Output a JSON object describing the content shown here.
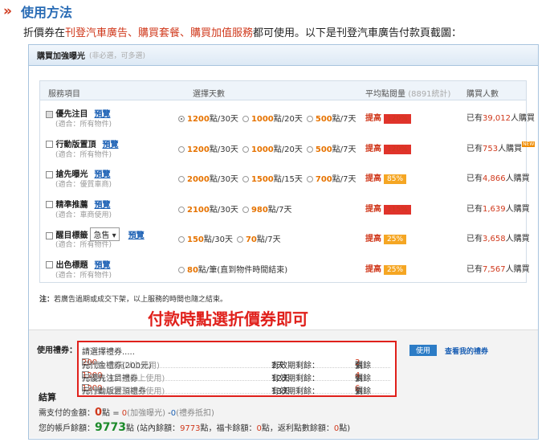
{
  "header": {
    "icon": "»",
    "title": "使用方法"
  },
  "intro": {
    "prefix": "折價券在",
    "highlight": "刊登汽車廣告、購買套餐、購買加值服務",
    "suffix": "都可使用。以下是刊登汽車廣告付款頁截圖："
  },
  "section": {
    "title": "購買加強曝光",
    "subtitle": "(非必選，可多選)"
  },
  "table": {
    "headers": {
      "item": "服務項目",
      "days": "選擇天數",
      "views": "平均點閱量",
      "views_note": "(8891統計)",
      "buyers": "購買人數"
    },
    "preview": "預覽",
    "rows": [
      {
        "name": "優先注目",
        "sub": "(適合：所有物件)",
        "checked": true,
        "preview": true,
        "options": [
          {
            "pts": "1200",
            "unit": "點/30天",
            "on": true
          },
          {
            "pts": "1000",
            "unit": "點/20天"
          },
          {
            "pts": "500",
            "unit": "點/7天"
          }
        ],
        "rank_label": "提高",
        "rank": "120%",
        "badge": "red",
        "buyers_pre": "已有",
        "buyers": "39,012",
        "buyers_post": "人購買"
      },
      {
        "name": "行動版置頂",
        "sub": "(適合：所有物件)",
        "preview": true,
        "options": [
          {
            "pts": "1200",
            "unit": "點/30天"
          },
          {
            "pts": "1000",
            "unit": "點/20天"
          },
          {
            "pts": "500",
            "unit": "點/7天"
          }
        ],
        "rank_label": "提高",
        "rank": "120%",
        "badge": "red",
        "buyers_pre": "已有",
        "buyers": "753",
        "buyers_post": "人購買",
        "new": "NEW"
      },
      {
        "name": "搶先曝光",
        "sub": "(適合：優質車商)",
        "preview": true,
        "options": [
          {
            "pts": "2000",
            "unit": "點/30天"
          },
          {
            "pts": "1500",
            "unit": "點/15天"
          },
          {
            "pts": "700",
            "unit": "點/7天"
          }
        ],
        "rank_label": "提高",
        "rank": "85%",
        "badge": "org",
        "buyers_pre": "已有",
        "buyers": "4,866",
        "buyers_post": "人購買"
      },
      {
        "name": "精準推薦",
        "sub": "(適合：車商使用)",
        "preview": true,
        "options": [
          {
            "pts": "2100",
            "unit": "點/30天"
          },
          {
            "pts": "980",
            "unit": "點/7天"
          }
        ],
        "rank_label": "提高",
        "rank": "115%",
        "badge": "red",
        "buyers_pre": "已有",
        "buyers": "1,639",
        "buyers_post": "人購買"
      },
      {
        "name": "醒目標籤",
        "select": "急售",
        "sub": "(適合：所有物件)",
        "preview": true,
        "options": [
          {
            "pts": "150",
            "unit": "點/30天"
          },
          {
            "pts": "70",
            "unit": "點/7天"
          }
        ],
        "rank_label": "提高",
        "rank": "25%",
        "badge": "org",
        "buyers_pre": "已有",
        "buyers": "3,658",
        "buyers_post": "人購買"
      },
      {
        "name": "出色標題",
        "sub": "(適合：所有物件)",
        "preview": true,
        "options": [
          {
            "pts": "80",
            "unit": "點/筆(直到物件時間結束)"
          }
        ],
        "rank_label": "提高",
        "rank": "25%",
        "badge": "org",
        "buyers_pre": "已有",
        "buyers": "7,567",
        "buyers_post": "人購買"
      }
    ]
  },
  "note": {
    "label": "注：",
    "text": "若廣告過期或成交下架，以上服務的時間也隨之結束。"
  },
  "callout": "付款時點選折價券即可",
  "payment": {
    "coupon_label": "使用禮券：",
    "placeholder": "請選擇禮券.....",
    "coupons": [
      {
        "amount": "200",
        "name": "元代金禮券(200元)",
        "cond": "(消費200元以上使用)",
        "exp_label": "有效期剩餘：",
        "exp": "2天",
        "rem_label": "剩餘",
        "rem": "3",
        "rem_unit": "張"
      },
      {
        "amount": "1200",
        "name": "元優先注目禮券",
        "cond": "(消費1200元以上使用)",
        "exp_label": "有效期剩餘：",
        "exp": "12天",
        "rem_label": "剩餘",
        "rem": "4",
        "rem_unit": "張"
      },
      {
        "amount": "1200",
        "name": "元行動版置頂禮券",
        "cond": "(消費1200元以上使用)",
        "exp_label": "有效期剩餘：",
        "exp": "13天",
        "rem_label": "剩餘",
        "rem": "6",
        "rem_unit": "張"
      }
    ],
    "use_button": "使用",
    "my_coupons": "查看我的禮券",
    "settle_title": "結算",
    "due_label": "需支付的金額：",
    "due": "0",
    "due_unit": "點 =",
    "due_expr1": "0",
    "due_expr1_note": "(加強曝光)",
    "due_minus": "-",
    "due_expr2": "0",
    "due_expr2_note": "(禮券抵扣)",
    "balance_label": "您的帳戶餘額：",
    "balance": "9773",
    "balance_unit": "點",
    "balance_detail_pre": "(站內餘額：",
    "balance_site": "9773",
    "balance_detail_mid1": "點，福卡餘額：",
    "balance_card": "0",
    "balance_detail_mid2": "點，返利點數餘額：",
    "balance_rebate": "0",
    "balance_detail_post": "點)"
  }
}
